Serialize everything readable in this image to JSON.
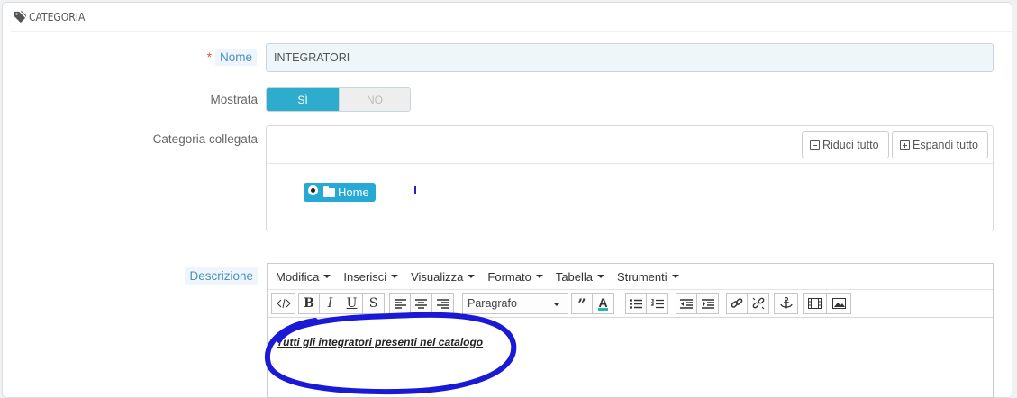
{
  "panel": {
    "title": "CATEGORIA"
  },
  "form": {
    "name_label": "Nome",
    "name_required": "*",
    "name_value": "INTEGRATORI",
    "shown_label": "Mostrata",
    "shown_on": "SÌ",
    "shown_off": "NO",
    "shown_value": true,
    "linked_label": "Categoria collegata",
    "collapse_label": "Riduci tutto",
    "expand_label": "Espandi tutto",
    "tree_root": "Home",
    "description_label": "Descrizione"
  },
  "editor": {
    "menus": [
      "Modifica",
      "Inserisci",
      "Visualizza",
      "Formato",
      "Tabella",
      "Strumenti"
    ],
    "format_select": "Paragrafo",
    "content": "Tutti gli integratori presenti nel catalogo"
  },
  "colors": {
    "accent": "#2eacce",
    "node": "#27a9d6",
    "required": "#e74c3c",
    "annotation": "#1a1ad6"
  },
  "icons": [
    "tag-icon",
    "minus-square-icon",
    "plus-square-icon",
    "folder-icon",
    "code-icon",
    "bold-icon",
    "italic-icon",
    "underline-icon",
    "strikethrough-icon",
    "align-left-icon",
    "align-center-icon",
    "align-right-icon",
    "blockquote-icon",
    "text-color-icon",
    "bullet-list-icon",
    "numbered-list-icon",
    "outdent-icon",
    "indent-icon",
    "link-icon",
    "unlink-icon",
    "anchor-icon",
    "media-icon",
    "image-icon"
  ]
}
